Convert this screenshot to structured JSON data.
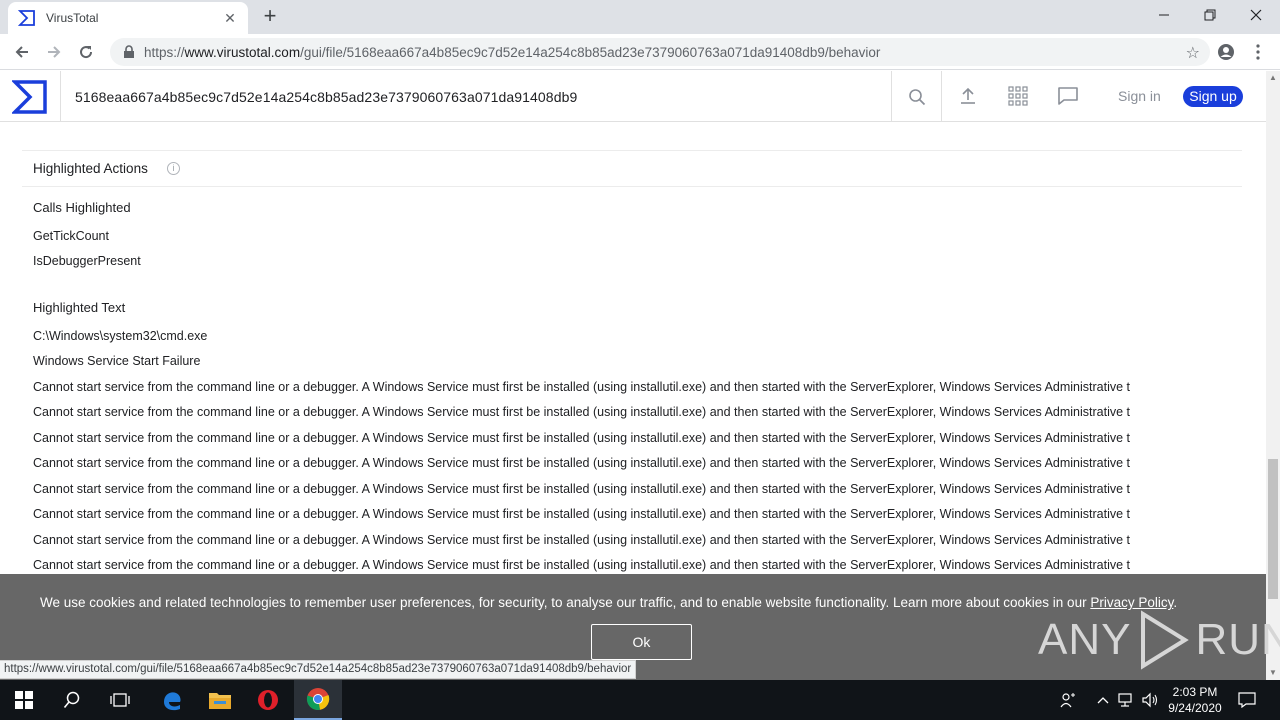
{
  "browser": {
    "tab_title": "VirusTotal",
    "url_prefix": "https://",
    "url_host": "www.virustotal.com",
    "url_path": "/gui/file/5168eaa667a4b85ec9c7d52e14a254c8b85ad23e7379060763a071da91408db9/behavior"
  },
  "header": {
    "search_value": "5168eaa667a4b85ec9c7d52e14a254c8b85ad23e7379060763a071da91408db9",
    "sign_in": "Sign in",
    "sign_up": "Sign up",
    "brand_color": "#1a3edb"
  },
  "main": {
    "section_title": "Highlighted Actions",
    "calls_title": "Calls Highlighted",
    "calls": [
      "GetTickCount",
      "IsDebuggerPresent"
    ],
    "text_title": "Highlighted Text",
    "texts": [
      "C:\\Windows\\system32\\cmd.exe",
      "Windows Service Start Failure",
      "Cannot start service from the command line or a debugger. A Windows Service must first be installed (using installutil.exe) and then started with the ServerExplorer, Windows Services Administrative t",
      "Cannot start service from the command line or a debugger. A Windows Service must first be installed (using installutil.exe) and then started with the ServerExplorer, Windows Services Administrative t",
      "Cannot start service from the command line or a debugger. A Windows Service must first be installed (using installutil.exe) and then started with the ServerExplorer, Windows Services Administrative t",
      "Cannot start service from the command line or a debugger. A Windows Service must first be installed (using installutil.exe) and then started with the ServerExplorer, Windows Services Administrative t",
      "Cannot start service from the command line or a debugger. A Windows Service must first be installed (using installutil.exe) and then started with the ServerExplorer, Windows Services Administrative t",
      "Cannot start service from the command line or a debugger. A Windows Service must first be installed (using installutil.exe) and then started with the ServerExplorer, Windows Services Administrative t",
      "Cannot start service from the command line or a debugger. A Windows Service must first be installed (using installutil.exe) and then started with the ServerExplorer, Windows Services Administrative t",
      "Cannot start service from the command line or a debugger. A Windows Service must first be installed (using installutil.exe) and then started with the ServerExplorer, Windows Services Administrative t"
    ]
  },
  "cookie": {
    "text": "We use cookies and related technologies to remember user preferences, for security, to analyse our traffic, and to enable website functionality. Learn more about cookies in our ",
    "link": "Privacy Policy",
    "tail": ".",
    "ok": "Ok"
  },
  "watermark": "ANY RUN",
  "status_url": "https://www.virustotal.com/gui/file/5168eaa667a4b85ec9c7d52e14a254c8b85ad23e7379060763a071da91408db9/behavior",
  "taskbar": {
    "time": "2:03 PM",
    "date": "9/24/2020"
  }
}
